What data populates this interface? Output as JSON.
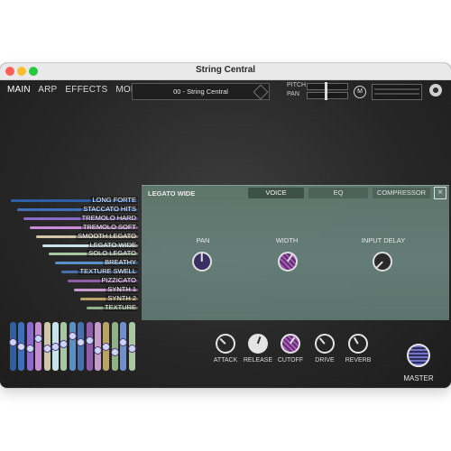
{
  "window": {
    "title": "String Central"
  },
  "topnav": {
    "tabs": [
      "MAIN",
      "ARP",
      "EFFECTS",
      "MOD"
    ],
    "active": "MAIN"
  },
  "preset": {
    "name": "00 - String Central"
  },
  "header": {
    "pitch_label": "PITCH",
    "pan_label": "PAN",
    "m_label": "M"
  },
  "panel": {
    "title": "LEGATO WIDE",
    "tabs": [
      "VOICE",
      "EQ",
      "COMPRESSOR"
    ],
    "active_tab": "VOICE",
    "knobs": [
      {
        "label": "PAN",
        "value": 0.5
      },
      {
        "label": "WIDTH",
        "value": 0.6
      },
      {
        "label": "INPUT DELAY",
        "value": 0.2
      }
    ]
  },
  "articulations": [
    {
      "label": "LONG FORTE",
      "color": "#2f5fa3"
    },
    {
      "label": "STACCATO HITS",
      "color": "#3f6fb8"
    },
    {
      "label": "TREMOLO HARD",
      "color": "#8c6bc8"
    },
    {
      "label": "TREMOLO SOFT",
      "color": "#c88bd8"
    },
    {
      "label": "SMOOTH LEGATO",
      "color": "#cfc7a8"
    },
    {
      "label": "LEGATO WIDE",
      "color": "#c9e3ea"
    },
    {
      "label": "SOLO LEGATO",
      "color": "#a7c7a0"
    },
    {
      "label": "BREATHY",
      "color": "#5a90c8"
    },
    {
      "label": "TEXTURE SWELL",
      "color": "#4b6fa8"
    },
    {
      "label": "PIZZICATO",
      "color": "#8e5fa6"
    },
    {
      "label": "SYNTH 1",
      "color": "#c79ad0"
    },
    {
      "label": "SYNTH 2",
      "color": "#b8a26a"
    },
    {
      "label": "TEXTURE",
      "color": "#8fb08a"
    }
  ],
  "fader_levels": [
    0.6,
    0.5,
    0.45,
    0.7,
    0.45,
    0.5,
    0.55,
    0.75,
    0.6,
    0.65,
    0.4,
    0.5,
    0.35,
    0.6,
    0.45
  ],
  "fader_colors": [
    "#2f5fa3",
    "#3f6fb8",
    "#8c6bc8",
    "#c88bd8",
    "#cfc7a8",
    "#c9e3ea",
    "#a7c7a0",
    "#5a90c8",
    "#4b6fa8",
    "#8e5fa6",
    "#c79ad0",
    "#b8a26a",
    "#8fb08a",
    "#6f8fd0",
    "#a8c8a0"
  ],
  "bottom_knobs": [
    {
      "label": "ATTACK",
      "value": 0.1
    },
    {
      "label": "RELEASE",
      "value": 0.45
    },
    {
      "label": "CUTOFF",
      "value": 0.55
    },
    {
      "label": "DRIVE",
      "value": 0.15
    },
    {
      "label": "REVERB",
      "value": 0.3
    }
  ],
  "master": {
    "label": "MASTER"
  }
}
